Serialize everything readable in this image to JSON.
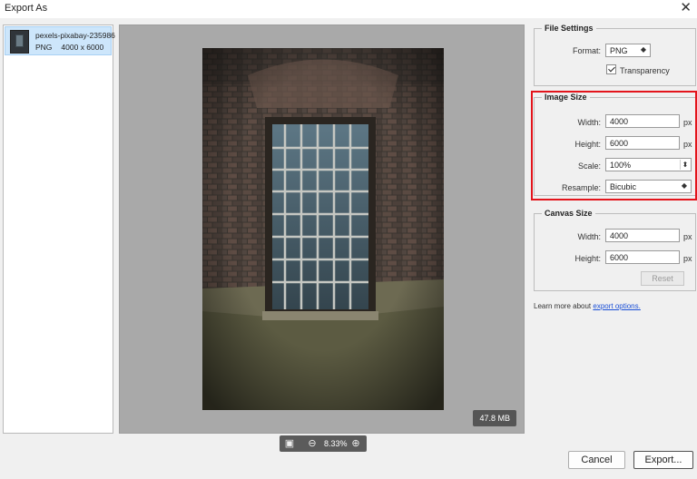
{
  "window": {
    "title": "Export As",
    "close_icon": "close-icon"
  },
  "assets": [
    {
      "name": "pexels-pixabay-235986",
      "format": "PNG",
      "dimensions": "4000 x 6000",
      "selected": true
    }
  ],
  "preview": {
    "file_size": "47.8 MB",
    "zoom": "8.33%"
  },
  "file_settings": {
    "legend": "File Settings",
    "format_label": "Format:",
    "format_value": "PNG",
    "transparency_label": "Transparency",
    "transparency_checked": true
  },
  "image_size": {
    "legend": "Image Size",
    "width_label": "Width:",
    "width_value": "4000",
    "width_unit": "px",
    "height_label": "Height:",
    "height_value": "6000",
    "height_unit": "px",
    "scale_label": "Scale:",
    "scale_value": "100%",
    "resample_label": "Resample:",
    "resample_value": "Bicubic",
    "highlight_color": "#e3141b"
  },
  "canvas_size": {
    "legend": "Canvas Size",
    "width_label": "Width:",
    "width_value": "4000",
    "width_unit": "px",
    "height_label": "Height:",
    "height_value": "6000",
    "height_unit": "px",
    "reset_label": "Reset"
  },
  "learn_more": {
    "prefix": "Learn more about ",
    "link": "export options."
  },
  "footer": {
    "cancel_label": "Cancel",
    "export_label": "Export..."
  }
}
